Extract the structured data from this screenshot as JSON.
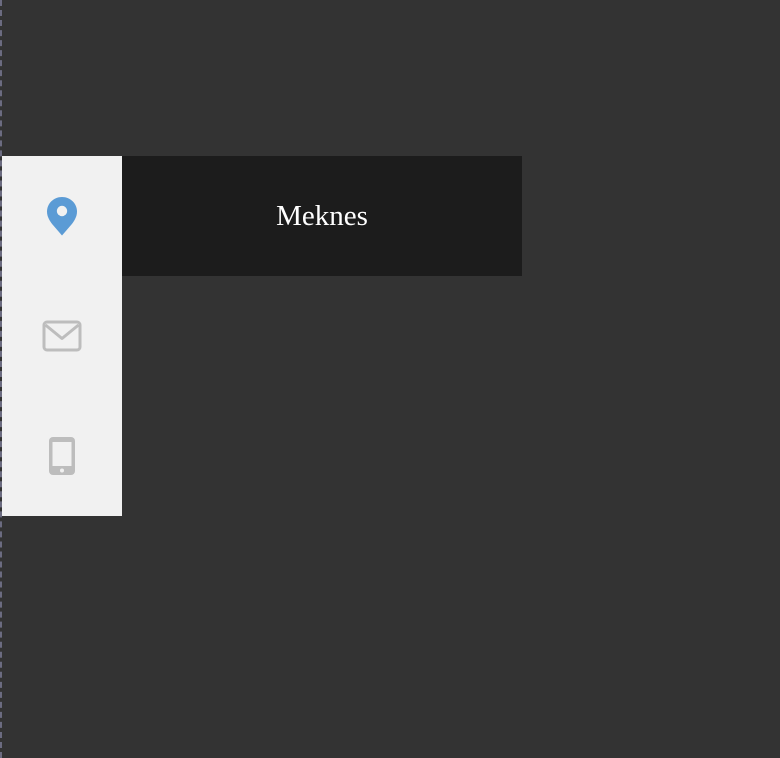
{
  "colors": {
    "page_background": "#333333",
    "rail_background": "#f1f1f1",
    "panel_background": "#1c1c1c",
    "active_icon": "#5b9bd5",
    "inactive_icon": "#bdbdbd",
    "panel_text": "#ffffff"
  },
  "rail": {
    "items": [
      {
        "icon": "map-marker-icon",
        "active": true
      },
      {
        "icon": "envelope-icon",
        "active": false
      },
      {
        "icon": "mobile-phone-icon",
        "active": false
      }
    ]
  },
  "panel": {
    "text": "Meknes"
  }
}
